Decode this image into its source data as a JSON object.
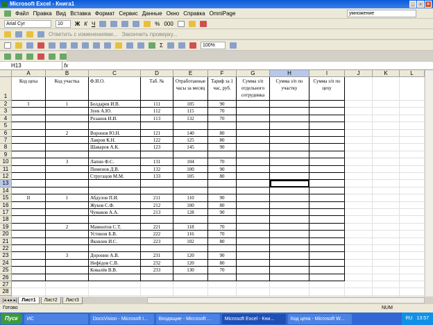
{
  "window": {
    "title": "Microsoft Excel - Книга1"
  },
  "menu": [
    "Файл",
    "Правка",
    "Вид",
    "Вставка",
    "Формат",
    "Сервис",
    "Данные",
    "Окно",
    "Справка",
    "OmniPage"
  ],
  "help_box": "умножение",
  "format_toolbar": {
    "font": "Arial Cyr",
    "size": "10",
    "bold": "Ж",
    "italic": "К",
    "underline": "Ч"
  },
  "review_toolbar": {
    "reply": "Ответить с изменениями...",
    "end_review": "Закончить проверку..."
  },
  "standard_toolbar": {
    "zoom": "100%"
  },
  "formula_bar": {
    "name_box": "H13",
    "fx": "fx",
    "value": ""
  },
  "columns": [
    "A",
    "B",
    "C",
    "D",
    "E",
    "F",
    "G",
    "H",
    "I",
    "J",
    "K",
    "L"
  ],
  "headers": [
    "Код цеха",
    "Код участка",
    "Ф.И.О.",
    "Таб. №",
    "Отработанные часы за месяц",
    "Тариф за 1 час, руб.",
    "Сумма з/п отдельного сотрудника",
    "Сумма з/п по участку",
    "Сумма з/п по цеху"
  ],
  "rows": [
    [
      "I",
      "1",
      "Болдарев И.В.",
      "111",
      "105",
      "90"
    ],
    [
      "",
      "",
      "Зуев А.Ю.",
      "112",
      "115",
      "70"
    ],
    [
      "",
      "",
      "Розанов И.И.",
      "113",
      "132",
      "70"
    ],
    [
      "",
      "",
      "",
      "",
      "",
      ""
    ],
    [
      "",
      "2",
      "Воронов Ю.Н.",
      "121",
      "140",
      "80"
    ],
    [
      "",
      "",
      "Лавров К.Н.",
      "122",
      "125",
      "80"
    ],
    [
      "",
      "",
      "Шаваров А.К.",
      "123",
      "145",
      "90"
    ],
    [
      "",
      "",
      "",
      "",
      "",
      ""
    ],
    [
      "",
      "3",
      "Лапин Ф.С.",
      "131",
      "104",
      "70"
    ],
    [
      "",
      "",
      "Пименов Д.В.",
      "132",
      "100",
      "90"
    ],
    [
      "",
      "",
      "Стругацов М.М.",
      "133",
      "105",
      "80"
    ],
    [
      "",
      "",
      "",
      "",
      "",
      ""
    ],
    [
      "",
      "",
      "",
      "",
      "",
      ""
    ],
    [
      "II",
      "1",
      "Абдулов П.И.",
      "211",
      "110",
      "90"
    ],
    [
      "",
      "",
      "Жуков С.Ф.",
      "212",
      "100",
      "80"
    ],
    [
      "",
      "",
      "Чумаков А.А.",
      "213",
      "128",
      "90"
    ],
    [
      "",
      "",
      "",
      "",
      "",
      ""
    ],
    [
      "",
      "2",
      "Мамонтов С.Т.",
      "221",
      "118",
      "70"
    ],
    [
      "",
      "",
      "Устинов Б.В.",
      "222",
      "116",
      "70"
    ],
    [
      "",
      "",
      "Яковлев И.С.",
      "223",
      "102",
      "80"
    ],
    [
      "",
      "",
      "",
      "",
      "",
      ""
    ],
    [
      "",
      "3",
      "Доронин А.В.",
      "231",
      "120",
      "90"
    ],
    [
      "",
      "",
      "Нефёдов С.В.",
      "232",
      "120",
      "80"
    ],
    [
      "",
      "",
      "Ковалёв В.В.",
      "233",
      "130",
      "70"
    ],
    [
      "",
      "",
      "",
      "",
      "",
      ""
    ],
    [
      "",
      "",
      "",
      "",
      "",
      ""
    ],
    [
      "",
      "",
      "",
      "",
      "",
      ""
    ]
  ],
  "sheet_tabs": [
    "Лист1",
    "Лист2",
    "Лист3"
  ],
  "status": {
    "ready": "Готово",
    "num": "NUM"
  },
  "taskbar": {
    "start": "Пуск",
    "items": [
      "ИС",
      "DocsVision - Microsoft I...",
      "Входящие - Microsoft ...",
      "Microsoft Excel - Кни...",
      "Код цеха - Microsoft W..."
    ],
    "lang": "RU",
    "time": "13:57"
  }
}
